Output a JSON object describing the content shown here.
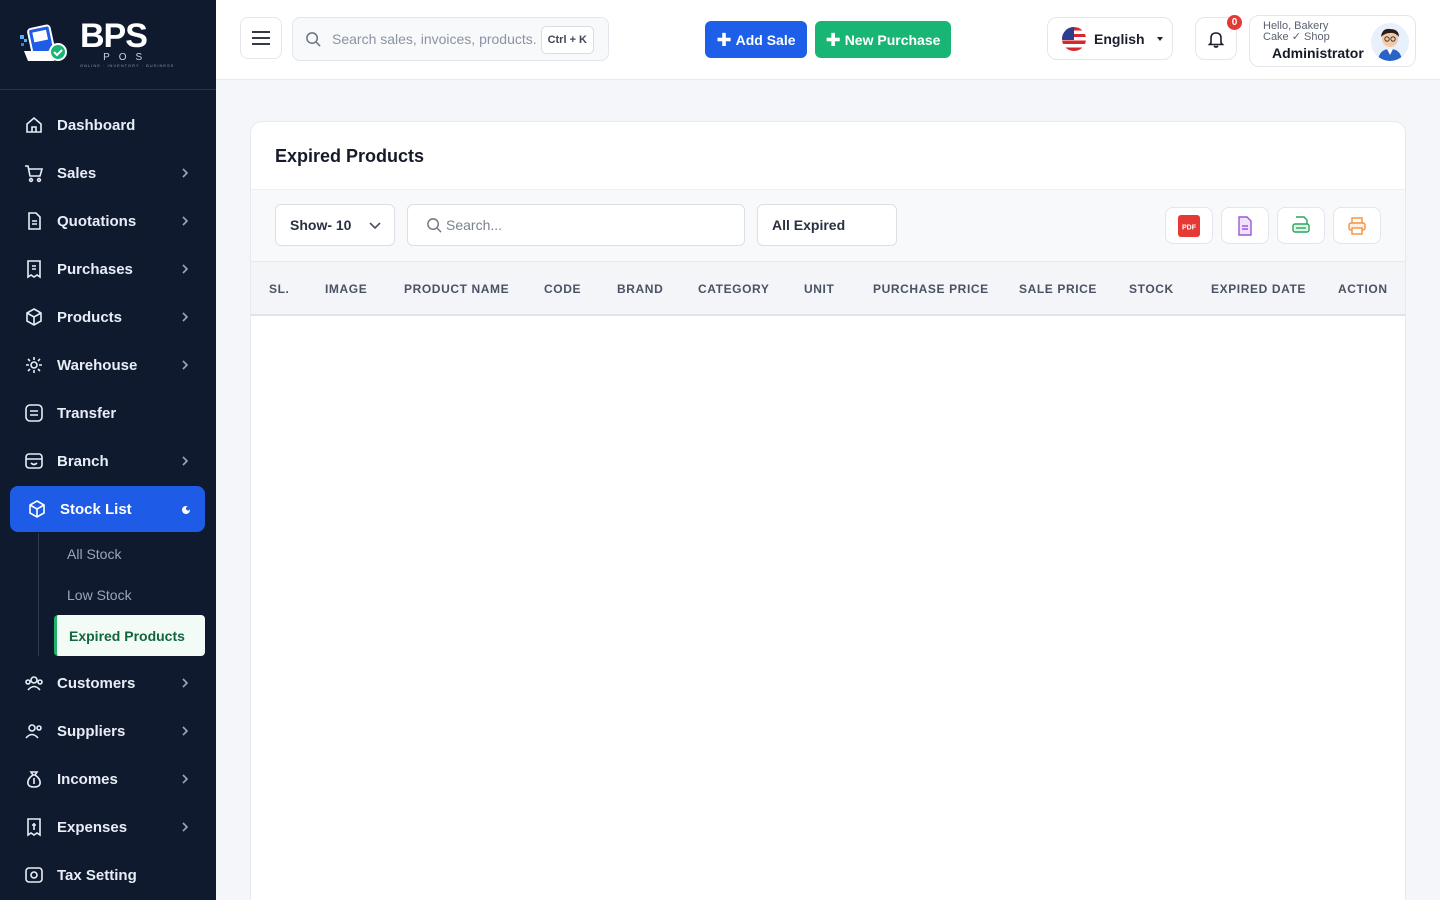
{
  "brand": {
    "name": "BPS",
    "sub": "POS",
    "tagline": "ONLINE · INVENTORY · BUSINESS"
  },
  "sidebar": {
    "items": [
      {
        "label": "Dashboard",
        "icon": "home-icon"
      },
      {
        "label": "Sales",
        "icon": "cart-icon"
      },
      {
        "label": "Quotations",
        "icon": "document-icon"
      },
      {
        "label": "Purchases",
        "icon": "receipt-icon"
      },
      {
        "label": "Products",
        "icon": "box-icon"
      },
      {
        "label": "Warehouse",
        "icon": "warehouse-icon"
      },
      {
        "label": "Transfer",
        "icon": "transfer-icon"
      },
      {
        "label": "Branch",
        "icon": "store-icon"
      },
      {
        "label": "Stock List",
        "icon": "cube-icon"
      },
      {
        "label": "Customers",
        "icon": "users-icon"
      },
      {
        "label": "Suppliers",
        "icon": "supplier-icon"
      },
      {
        "label": "Incomes",
        "icon": "money-bag-icon"
      },
      {
        "label": "Expenses",
        "icon": "expense-icon"
      },
      {
        "label": "Tax Setting",
        "icon": "tax-icon"
      }
    ],
    "stock_sub": [
      "All Stock",
      "Low Stock",
      "Expired Products"
    ]
  },
  "topbar": {
    "search_placeholder": "Search sales, invoices, products...",
    "shortcut": "Ctrl + K",
    "add_sale": "Add Sale",
    "new_purchase": "New Purchase",
    "language": "English",
    "notif_count": "0",
    "greeting": "Hello, Bakery Cake ✓ Shop",
    "role": "Administrator"
  },
  "page": {
    "title": "Expired Products",
    "show_label": "Show- 10",
    "search_placeholder": "Search...",
    "filter_label": "All Expired",
    "pdf_label": "PDF",
    "columns": [
      "SL.",
      "IMAGE",
      "PRODUCT NAME",
      "CODE",
      "BRAND",
      "CATEGORY",
      "UNIT",
      "PURCHASE PRICE",
      "SALE PRICE",
      "STOCK",
      "EXPIRED DATE",
      "ACTION"
    ]
  },
  "colors": {
    "sidebar": "#0f1a2f",
    "accent": "#1e5be6",
    "green": "#18b575"
  }
}
